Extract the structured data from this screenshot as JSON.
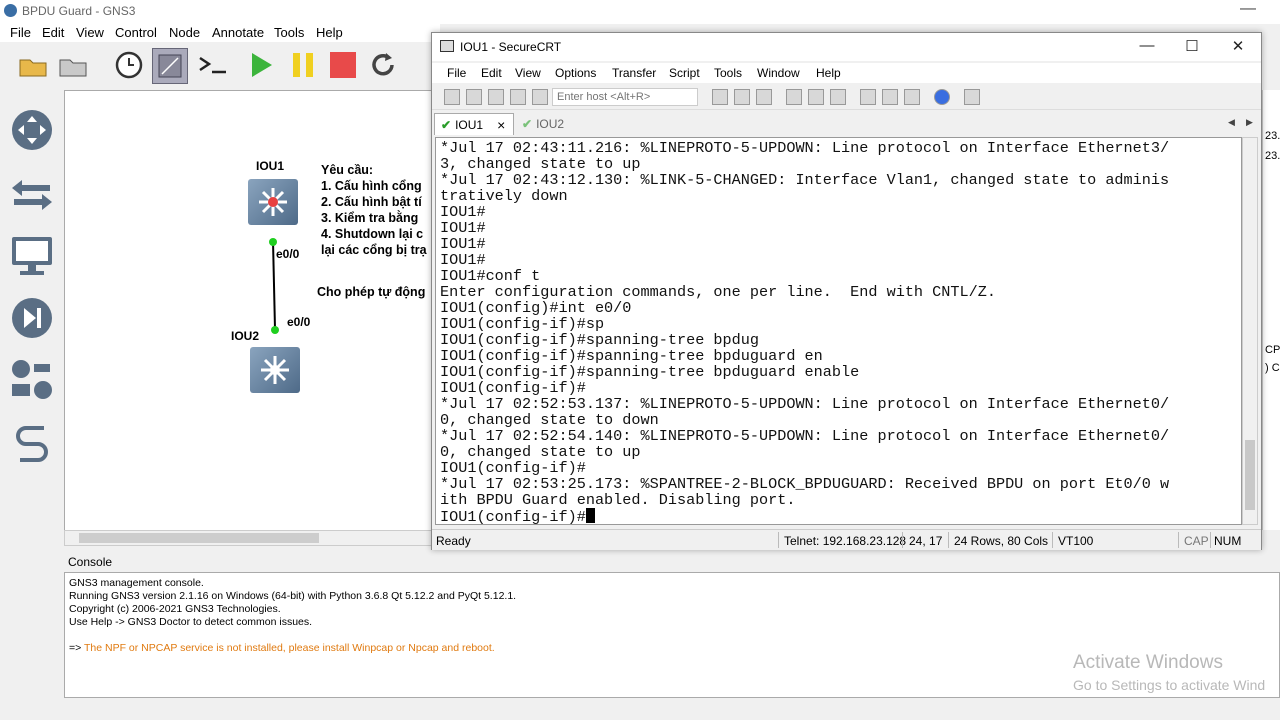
{
  "gns3": {
    "window_title": "BPDU Guard - GNS3",
    "menu": [
      "File",
      "Edit",
      "View",
      "Control",
      "Node",
      "Annotate",
      "Tools",
      "Help"
    ],
    "window_min": "—",
    "canvas": {
      "node1_label": "IOU1",
      "node2_label": "IOU2",
      "port1_label": "e0/0",
      "port2_label": "e0/0",
      "requirements": [
        "Yêu cầu:",
        "1. Cấu hình cổng",
        "2. Cấu hình bật tí",
        "3. Kiểm tra bằng",
        "4. Shutdown lại c",
        "lại các cổng bị trạ"
      ],
      "note": "Cho phép tự động"
    },
    "right_peek": [
      "23.",
      "23.",
      "CP",
      ") C"
    ],
    "console": {
      "title": "Console",
      "lines": [
        "GNS3 management console.",
        "Running GNS3 version 2.1.16 on Windows (64-bit) with Python 3.6.8 Qt 5.12.2 and PyQt 5.12.1.",
        "Copyright (c) 2006-2021 GNS3 Technologies.",
        "Use Help -> GNS3 Doctor to detect common issues."
      ],
      "warning_prefix": "=>",
      "warning": "The NPF or NPCAP service is not installed, please install Winpcap or Npcap and reboot."
    },
    "activate_title": "Activate Windows",
    "activate_sub": "Go to Settings to activate Wind"
  },
  "crt": {
    "title": "IOU1 - SecureCRT",
    "controls": {
      "min": "—",
      "max": "☐",
      "close": "✕"
    },
    "menu": [
      "File",
      "Edit",
      "View",
      "Options",
      "Transfer",
      "Script",
      "Tools",
      "Window",
      "Help"
    ],
    "host_placeholder": "Enter host <Alt+R>",
    "tabs": [
      {
        "label": "IOU1",
        "active": true
      },
      {
        "label": "IOU2",
        "active": false
      }
    ],
    "tab_close": "×",
    "terminal_lines": [
      "*Jul 17 02:43:11.216: %LINEPROTO-5-UPDOWN: Line protocol on Interface Ethernet3/",
      "3, changed state to up",
      "*Jul 17 02:43:12.130: %LINK-5-CHANGED: Interface Vlan1, changed state to adminis",
      "tratively down",
      "IOU1#",
      "IOU1#",
      "IOU1#",
      "IOU1#",
      "IOU1#conf t",
      "Enter configuration commands, one per line.  End with CNTL/Z.",
      "IOU1(config)#int e0/0",
      "IOU1(config-if)#sp",
      "IOU1(config-if)#spanning-tree bpdug",
      "IOU1(config-if)#spanning-tree bpduguard en",
      "IOU1(config-if)#spanning-tree bpduguard enable",
      "IOU1(config-if)#",
      "*Jul 17 02:52:53.137: %LINEPROTO-5-UPDOWN: Line protocol on Interface Ethernet0/",
      "0, changed state to down",
      "*Jul 17 02:52:54.140: %LINEPROTO-5-UPDOWN: Line protocol on Interface Ethernet0/",
      "0, changed state to up",
      "IOU1(config-if)#",
      "*Jul 17 02:53:25.173: %SPANTREE-2-BLOCK_BPDUGUARD: Received BPDU on port Et0/0 w",
      "ith BPDU Guard enabled. Disabling port.",
      "IOU1(config-if)#"
    ],
    "status": {
      "ready": "Ready",
      "telnet": "Telnet: 192.168.23.128",
      "cursor": "24,  17",
      "size": "24 Rows, 80 Cols",
      "emulation": "VT100",
      "cap": "CAP",
      "num": "NUM"
    },
    "tab_nav": [
      "◀",
      "▶"
    ]
  }
}
